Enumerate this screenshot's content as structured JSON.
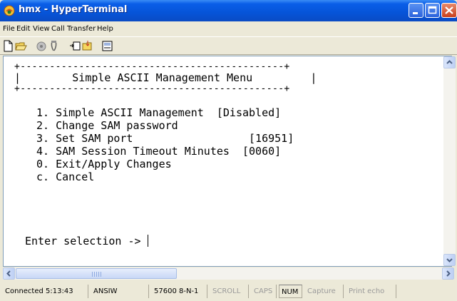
{
  "window": {
    "title": "hmx - HyperTerminal"
  },
  "menu": [
    "File",
    "Edit",
    "View",
    "Call",
    "Transfer",
    "Help"
  ],
  "toolbar_icons": [
    "new-icon",
    "open-icon",
    "disconnect-icon",
    "dial-icon",
    "send-icon",
    "receive-icon",
    "properties-icon"
  ],
  "terminal": {
    "border_top": "+---------------------------------------------+",
    "header_line": "|        Simple ASCII Management Menu         |",
    "border_bottom": "+---------------------------------------------+",
    "items": [
      "1. Simple ASCII Management  [Disabled]",
      "2. Change SAM password",
      "3. Set SAM port                  [16951]",
      "4. SAM Session Timeout Minutes  [0060]",
      "0. Exit/Apply Changes",
      "c. Cancel"
    ],
    "prompt": "Enter selection -> "
  },
  "status": {
    "connected": "Connected 5:13:43",
    "emulation": "ANSIW",
    "port_settings": "57600 8-N-1",
    "scroll": "SCROLL",
    "caps": "CAPS",
    "num": "NUM",
    "capture": "Capture",
    "print_echo": "Print echo"
  },
  "colors": {
    "titlebar": "#0654d8",
    "close_button": "#c8401d",
    "chrome": "#ece9d8"
  }
}
